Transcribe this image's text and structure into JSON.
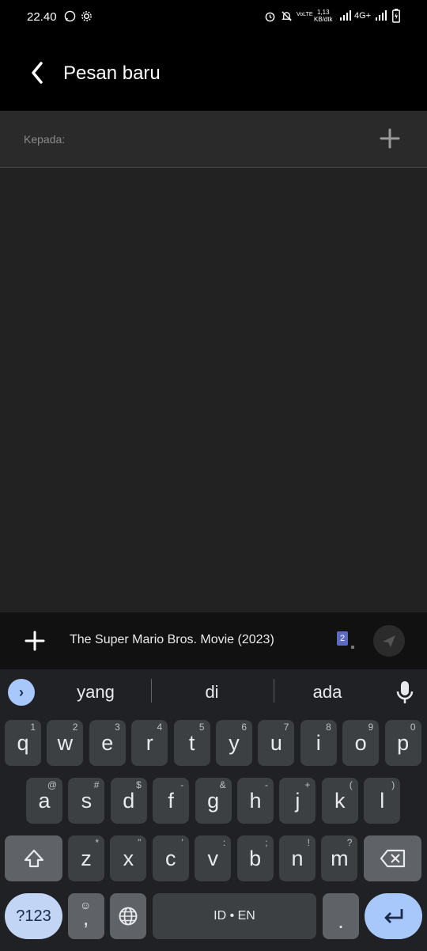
{
  "status_bar": {
    "time": "22.40",
    "speed_value": "1,13",
    "speed_unit": "KB/dtk",
    "network": "4G+",
    "volte": "VoLTE"
  },
  "header": {
    "title": "Pesan baru"
  },
  "recipient": {
    "label": "Kepada:"
  },
  "compose": {
    "message": "The Super Mario Bros. Movie (2023)",
    "sim": "2"
  },
  "keyboard": {
    "suggestions": [
      "yang",
      "di",
      "ada"
    ],
    "row1": [
      {
        "k": "q",
        "h": "1"
      },
      {
        "k": "w",
        "h": "2"
      },
      {
        "k": "e",
        "h": "3"
      },
      {
        "k": "r",
        "h": "4"
      },
      {
        "k": "t",
        "h": "5"
      },
      {
        "k": "y",
        "h": "6"
      },
      {
        "k": "u",
        "h": "7"
      },
      {
        "k": "i",
        "h": "8"
      },
      {
        "k": "o",
        "h": "9"
      },
      {
        "k": "p",
        "h": "0"
      }
    ],
    "row2": [
      {
        "k": "a",
        "h": "@"
      },
      {
        "k": "s",
        "h": "#"
      },
      {
        "k": "d",
        "h": "$"
      },
      {
        "k": "f",
        "h": "-"
      },
      {
        "k": "g",
        "h": "&"
      },
      {
        "k": "h",
        "h": "-"
      },
      {
        "k": "j",
        "h": "+"
      },
      {
        "k": "k",
        "h": "("
      },
      {
        "k": "l",
        "h": ")"
      }
    ],
    "row3": [
      {
        "k": "z",
        "h": "*"
      },
      {
        "k": "x",
        "h": "\""
      },
      {
        "k": "c",
        "h": "'"
      },
      {
        "k": "v",
        "h": ":"
      },
      {
        "k": "b",
        "h": ";"
      },
      {
        "k": "n",
        "h": "!"
      },
      {
        "k": "m",
        "h": "?"
      }
    ],
    "symbols_label": "?123",
    "comma": ",",
    "space_label": "ID • EN",
    "period": "."
  },
  "colors": {
    "accent": "#a8c7fa",
    "key": "#3c4043",
    "keyboard_bg": "#202124"
  }
}
